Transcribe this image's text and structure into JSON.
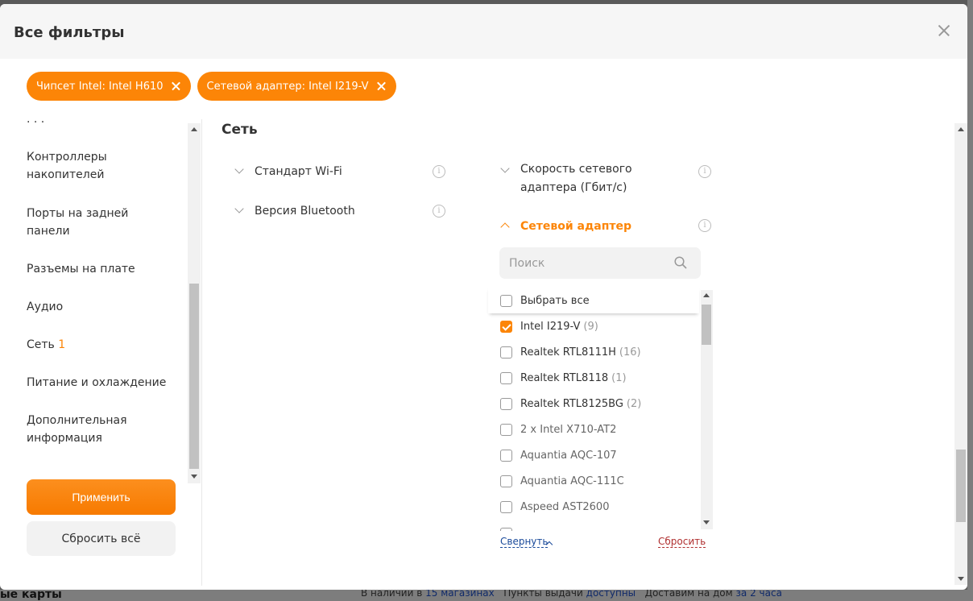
{
  "modal": {
    "title": "Все фильтры"
  },
  "active_filters": [
    {
      "label": "Чипсет Intel: Intel H610"
    },
    {
      "label": "Сетевой адаптер: Intel I219-V"
    }
  ],
  "sidebar": {
    "items": [
      {
        "label": "Контроллеры накопителей"
      },
      {
        "label": "Порты на задней панели"
      },
      {
        "label": "Разъемы на плате"
      },
      {
        "label": "Аудио"
      },
      {
        "label": "Сеть",
        "count": "1"
      },
      {
        "label": "Питание и охлаждение"
      },
      {
        "label": "Дополнительная информация"
      }
    ],
    "apply_label": "Применить",
    "reset_label": "Сбросить всё"
  },
  "section": {
    "title": "Сеть",
    "filters_left": [
      {
        "label": "Стандарт Wi-Fi"
      },
      {
        "label": "Версия Bluetooth"
      }
    ],
    "filter_speed": {
      "label": "Скорость сетевого адаптера (Гбит/с)"
    },
    "filter_adapter": {
      "label": "Сетевой адаптер",
      "search_placeholder": "Поиск",
      "select_all_label": "Выбрать все",
      "options": [
        {
          "label": "Intel I219-V",
          "count": "(9)",
          "checked": true
        },
        {
          "label": "Realtek RTL8111H",
          "count": "(16)",
          "checked": false
        },
        {
          "label": "Realtek RTL8118",
          "count": "(1)",
          "checked": false
        },
        {
          "label": "Realtek RTL8125BG",
          "count": "(2)",
          "checked": false
        },
        {
          "label": "2 x Intel X710-AT2",
          "count": "",
          "checked": false
        },
        {
          "label": "Aquantia AQC-107",
          "count": "",
          "checked": false
        },
        {
          "label": "Aquantia AQC-111C",
          "count": "",
          "checked": false
        },
        {
          "label": "Aspeed AST2600",
          "count": "",
          "checked": false
        }
      ],
      "collapse_label": "Свернуть",
      "reset_label": "Сбросить"
    }
  },
  "background": {
    "bottom_left_text": "ые карты",
    "stock_text": "В наличии в",
    "stock_link": "15 магазинах",
    "pickup_text": "Пункты выдачи",
    "pickup_link": "доступны",
    "delivery_text": "Доставим на дом",
    "delivery_link": "за 2 часа"
  },
  "colors": {
    "accent": "#fc8507",
    "link": "#1a4a9a",
    "reset_link": "#b03030"
  }
}
